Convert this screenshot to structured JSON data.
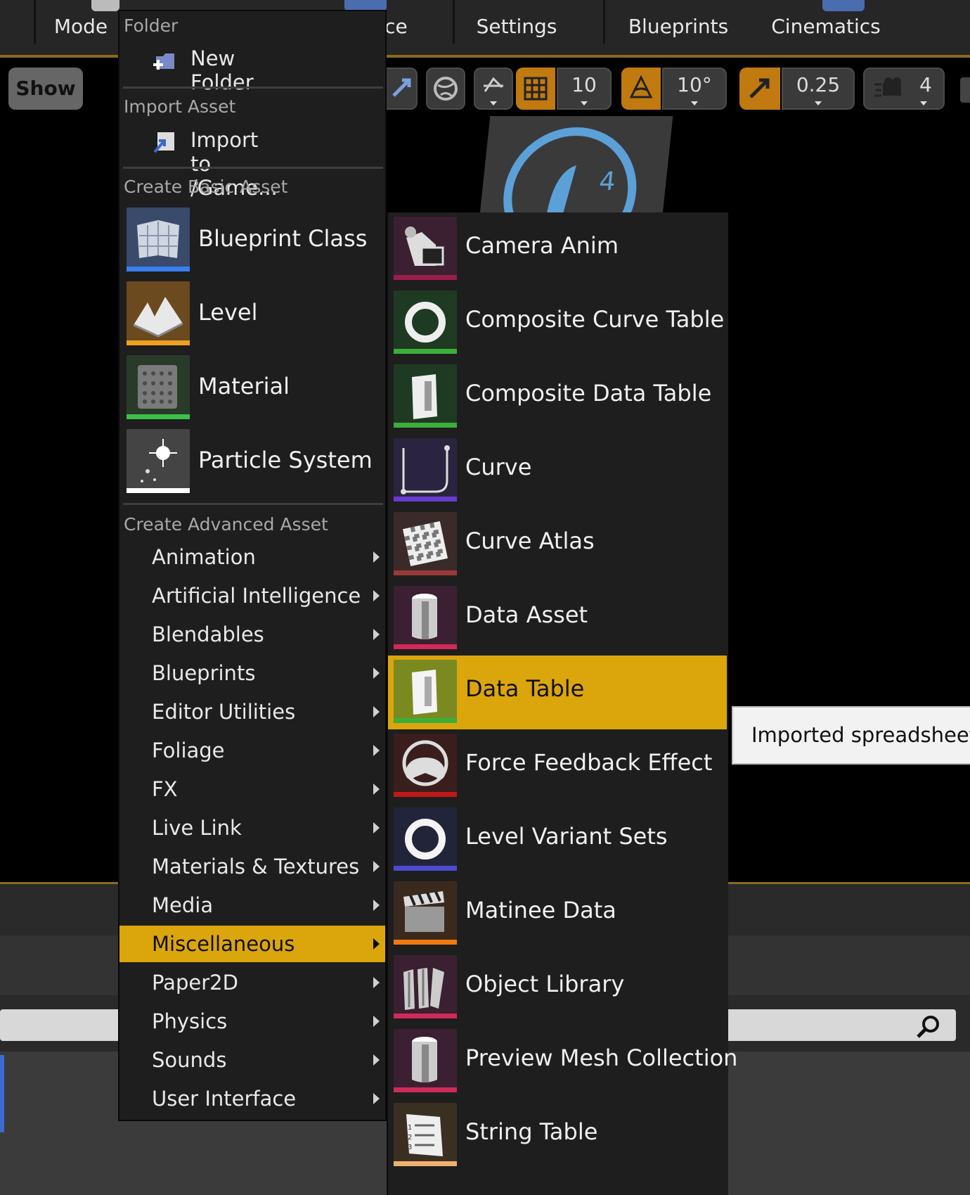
{
  "top_toolbar": {
    "buttons": [
      {
        "label": "Mode"
      },
      {
        "label": "ace"
      },
      {
        "label": "Settings"
      },
      {
        "label": "Blueprints"
      },
      {
        "label": "Cinematics"
      }
    ]
  },
  "viewport_toolbar": {
    "show_label": "Show",
    "grid_snap_value": "10",
    "rotation_snap_value": "10°",
    "scale_snap_value": "0.25",
    "camera_speed_value": "4"
  },
  "context_menu": {
    "folder_section": "Folder",
    "new_folder": "New Folder",
    "import_section": "Import Asset",
    "import_to": "Import to /Game...",
    "basic_section": "Create Basic Asset",
    "basic_assets": [
      {
        "label": "Blueprint Class",
        "icon": "blueprint-class-icon",
        "bar_color": "#3a7ff0"
      },
      {
        "label": "Level",
        "icon": "level-icon",
        "bar_color": "#f0a020"
      },
      {
        "label": "Material",
        "icon": "material-icon",
        "bar_color": "#3cc04a"
      },
      {
        "label": "Particle System",
        "icon": "particle-system-icon",
        "bar_color": "#ffffff"
      }
    ],
    "advanced_section": "Create Advanced Asset",
    "categories": [
      {
        "label": "Animation"
      },
      {
        "label": "Artificial Intelligence"
      },
      {
        "label": "Blendables"
      },
      {
        "label": "Blueprints"
      },
      {
        "label": "Editor Utilities"
      },
      {
        "label": "Foliage"
      },
      {
        "label": "FX"
      },
      {
        "label": "Live Link"
      },
      {
        "label": "Materials & Textures"
      },
      {
        "label": "Media"
      },
      {
        "label": "Miscellaneous"
      },
      {
        "label": "Paper2D"
      },
      {
        "label": "Physics"
      },
      {
        "label": "Sounds"
      },
      {
        "label": "User Interface"
      }
    ],
    "active_category": "Miscellaneous"
  },
  "submenu": {
    "items": [
      {
        "label": "Camera Anim",
        "icon": "camera-anim-icon",
        "bar_color": "#9a1e4a",
        "bg": "#3a2030"
      },
      {
        "label": "Composite Curve Table",
        "icon": "composite-curve-table-icon",
        "bar_color": "#3ab03a",
        "bg": "#1f3a22"
      },
      {
        "label": "Composite Data Table",
        "icon": "composite-data-table-icon",
        "bar_color": "#3ab03a",
        "bg": "#1f3a22"
      },
      {
        "label": "Curve",
        "icon": "curve-icon",
        "bar_color": "#6a3ad0",
        "bg": "#2a2440"
      },
      {
        "label": "Curve Atlas",
        "icon": "curve-atlas-icon",
        "bar_color": "#9a3a3a",
        "bg": "#3a2a2a"
      },
      {
        "label": "Data Asset",
        "icon": "data-asset-icon",
        "bar_color": "#d02a5a",
        "bg": "#3a2030"
      },
      {
        "label": "Data Table",
        "icon": "data-table-icon",
        "bar_color": "#3ab03a",
        "bg": "#7a8a20"
      },
      {
        "label": "Force Feedback Effect",
        "icon": "force-feedback-effect-icon",
        "bar_color": "#c01818",
        "bg": "#3a1e1e"
      },
      {
        "label": "Level Variant Sets",
        "icon": "level-variant-sets-icon",
        "bar_color": "#4a4ad0",
        "bg": "#22243a"
      },
      {
        "label": "Matinee Data",
        "icon": "matinee-data-icon",
        "bar_color": "#f07a10",
        "bg": "#3a2a1e"
      },
      {
        "label": "Object Library",
        "icon": "object-library-icon",
        "bar_color": "#d02a5a",
        "bg": "#3a2030"
      },
      {
        "label": "Preview Mesh Collection",
        "icon": "preview-mesh-collection-icon",
        "bar_color": "#d02a5a",
        "bg": "#3a2030"
      },
      {
        "label": "String Table",
        "icon": "string-table-icon",
        "bar_color": "#f0b070",
        "bg": "#3a3022"
      }
    ],
    "active_item": "Data Table"
  },
  "tooltip": {
    "text": "Imported spreadsheet t"
  }
}
